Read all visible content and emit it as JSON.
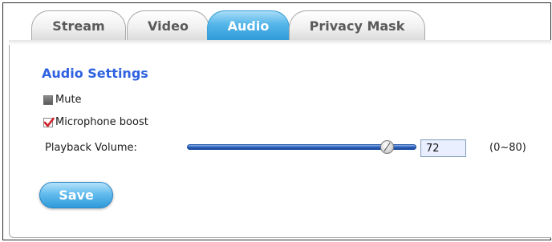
{
  "tabs": [
    {
      "label": "Stream",
      "active": false
    },
    {
      "label": "Video",
      "active": false
    },
    {
      "label": "Audio",
      "active": true
    },
    {
      "label": "Privacy Mask",
      "active": false
    }
  ],
  "audio_settings": {
    "title": "Audio Settings",
    "mute": {
      "label": "Mute",
      "checked": false
    },
    "microphone_boost": {
      "label": "Microphone boost",
      "checked": true
    },
    "playback_volume": {
      "label": "Playback Volume:",
      "value": "72",
      "range_text": "(0~80)",
      "min": 0,
      "max": 80
    },
    "save_label": "Save"
  },
  "colors": {
    "accent_blue": "#2f9bd9",
    "title_blue": "#2f62e0",
    "check_red": "#d2202b"
  }
}
